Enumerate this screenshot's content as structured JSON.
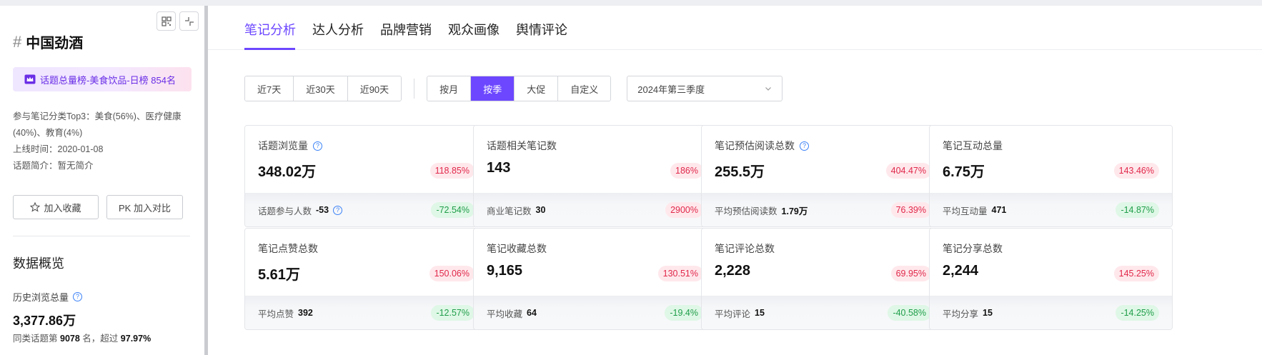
{
  "sidebar": {
    "hash": "#",
    "topic_name": "中国劲酒",
    "rank_badge": "话题总量榜-美食饮品-日榜 854名",
    "meta": {
      "categories": "参与笔记分类Top3：美食(56%)、医疗健康(40%)、教育(4%)",
      "online_time": "上线时间：2020-01-08",
      "intro": "话题简介：暂无简介"
    },
    "actions": {
      "favorite": "加入收藏",
      "compare": "PK 加入对比"
    },
    "overview_title": "数据概览",
    "history": {
      "label": "历史浏览总量",
      "value": "3,377.86万",
      "note_prefix": "同类话题第",
      "rank": "9078",
      "note_mid": "名，超过",
      "percent": "97.97%"
    }
  },
  "tabs": [
    "笔记分析",
    "达人分析",
    "品牌营销",
    "观众画像",
    "舆情评论"
  ],
  "active_tab": 0,
  "filters": {
    "range": [
      "近7天",
      "近30天",
      "近90天"
    ],
    "period": [
      "按月",
      "按季",
      "大促",
      "自定义"
    ],
    "period_active": 1,
    "select_value": "2024年第三季度"
  },
  "cards": [
    {
      "label": "话题浏览量",
      "help": true,
      "value": "348.02万",
      "change": "118.85%",
      "change_dir": "up",
      "sub_label": "话题参与人数",
      "sub_value": "-53",
      "sub_help": true,
      "sub_change": "-72.54%",
      "sub_change_dir": "down"
    },
    {
      "label": "话题相关笔记数",
      "help": false,
      "value": "143",
      "change": "186%",
      "change_dir": "up",
      "sub_label": "商业笔记数",
      "sub_value": "30",
      "sub_help": false,
      "sub_change": "2900%",
      "sub_change_dir": "up"
    },
    {
      "label": "笔记预估阅读总数",
      "help": true,
      "value": "255.5万",
      "change": "404.47%",
      "change_dir": "up",
      "sub_label": "平均预估阅读数",
      "sub_value": "1.79万",
      "sub_help": false,
      "sub_change": "76.39%",
      "sub_change_dir": "up"
    },
    {
      "label": "笔记互动总量",
      "help": false,
      "value": "6.75万",
      "change": "143.46%",
      "change_dir": "up",
      "sub_label": "平均互动量",
      "sub_value": "471",
      "sub_help": false,
      "sub_change": "-14.87%",
      "sub_change_dir": "down"
    },
    {
      "label": "笔记点赞总数",
      "help": false,
      "value": "5.61万",
      "change": "150.06%",
      "change_dir": "up",
      "sub_label": "平均点赞",
      "sub_value": "392",
      "sub_help": false,
      "sub_change": "-12.57%",
      "sub_change_dir": "down"
    },
    {
      "label": "笔记收藏总数",
      "help": false,
      "value": "9,165",
      "change": "130.51%",
      "change_dir": "up",
      "sub_label": "平均收藏",
      "sub_value": "64",
      "sub_help": false,
      "sub_change": "-19.4%",
      "sub_change_dir": "down"
    },
    {
      "label": "笔记评论总数",
      "help": false,
      "value": "2,228",
      "change": "69.95%",
      "change_dir": "up",
      "sub_label": "平均评论",
      "sub_value": "15",
      "sub_help": false,
      "sub_change": "-40.58%",
      "sub_change_dir": "down"
    },
    {
      "label": "笔记分享总数",
      "help": false,
      "value": "2,244",
      "change": "145.25%",
      "change_dir": "up",
      "sub_label": "平均分享",
      "sub_value": "15",
      "sub_help": false,
      "sub_change": "-14.25%",
      "sub_change_dir": "down"
    }
  ],
  "colors": {
    "accent": "#6c47ff",
    "up": "#e0284a",
    "down": "#1f9e4a",
    "help": "#3b82f6"
  },
  "icons": [
    "qr-icon",
    "collapse-icon",
    "crown-icon",
    "star-icon",
    "help-icon",
    "chevron-down-icon"
  ]
}
